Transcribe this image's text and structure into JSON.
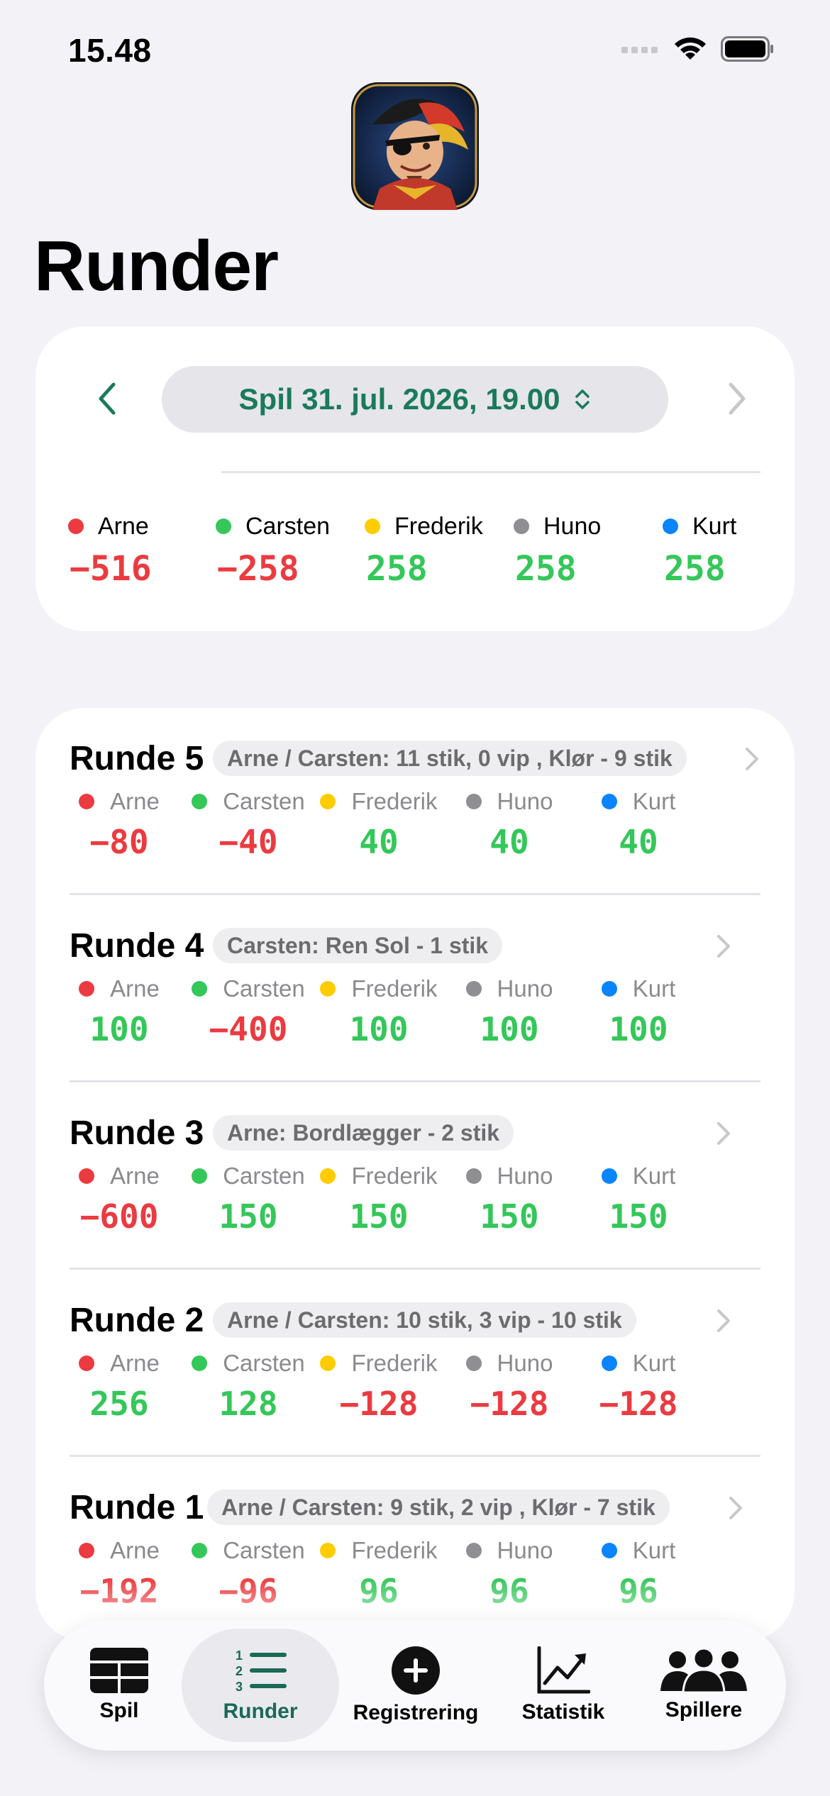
{
  "status_bar": {
    "time": "15.48"
  },
  "app": {
    "title": "Runder"
  },
  "game_picker": {
    "label": "Spil 31. jul. 2026, 19.00"
  },
  "totals": [
    {
      "name": "Arne",
      "color": "#eb3b40",
      "score": "−516",
      "sign": "neg"
    },
    {
      "name": "Carsten",
      "color": "#34c759",
      "score": "−258",
      "sign": "neg"
    },
    {
      "name": "Frederik",
      "color": "#ffcc00",
      "score": "258",
      "sign": "pos"
    },
    {
      "name": "Huno",
      "color": "#8e8e93",
      "score": "258",
      "sign": "pos"
    },
    {
      "name": "Kurt",
      "color": "#0a84ff",
      "score": "258",
      "sign": "pos"
    }
  ],
  "rounds": [
    {
      "title": "Runde 5",
      "desc": "Arne / Carsten: 11 stik, 0 vip , Klør - 9 stik",
      "players": [
        {
          "name": "Arne",
          "color": "#eb3b40",
          "score": "−80",
          "sign": "neg"
        },
        {
          "name": "Carsten",
          "color": "#34c759",
          "score": "−40",
          "sign": "neg"
        },
        {
          "name": "Frederik",
          "color": "#ffcc00",
          "score": "40",
          "sign": "pos"
        },
        {
          "name": "Huno",
          "color": "#8e8e93",
          "score": "40",
          "sign": "pos"
        },
        {
          "name": "Kurt",
          "color": "#0a84ff",
          "score": "40",
          "sign": "pos"
        }
      ]
    },
    {
      "title": "Runde 4",
      "desc": "Carsten: Ren Sol - 1 stik",
      "players": [
        {
          "name": "Arne",
          "color": "#eb3b40",
          "score": "100",
          "sign": "pos"
        },
        {
          "name": "Carsten",
          "color": "#34c759",
          "score": "−400",
          "sign": "neg"
        },
        {
          "name": "Frederik",
          "color": "#ffcc00",
          "score": "100",
          "sign": "pos"
        },
        {
          "name": "Huno",
          "color": "#8e8e93",
          "score": "100",
          "sign": "pos"
        },
        {
          "name": "Kurt",
          "color": "#0a84ff",
          "score": "100",
          "sign": "pos"
        }
      ]
    },
    {
      "title": "Runde 3",
      "desc": "Arne: Bordlægger - 2 stik",
      "players": [
        {
          "name": "Arne",
          "color": "#eb3b40",
          "score": "−600",
          "sign": "neg"
        },
        {
          "name": "Carsten",
          "color": "#34c759",
          "score": "150",
          "sign": "pos"
        },
        {
          "name": "Frederik",
          "color": "#ffcc00",
          "score": "150",
          "sign": "pos"
        },
        {
          "name": "Huno",
          "color": "#8e8e93",
          "score": "150",
          "sign": "pos"
        },
        {
          "name": "Kurt",
          "color": "#0a84ff",
          "score": "150",
          "sign": "pos"
        }
      ]
    },
    {
      "title": "Runde 2",
      "desc": "Arne / Carsten: 10 stik, 3 vip  - 10 stik",
      "players": [
        {
          "name": "Arne",
          "color": "#eb3b40",
          "score": "256",
          "sign": "pos"
        },
        {
          "name": "Carsten",
          "color": "#34c759",
          "score": "128",
          "sign": "pos"
        },
        {
          "name": "Frederik",
          "color": "#ffcc00",
          "score": "−128",
          "sign": "neg"
        },
        {
          "name": "Huno",
          "color": "#8e8e93",
          "score": "−128",
          "sign": "neg"
        },
        {
          "name": "Kurt",
          "color": "#0a84ff",
          "score": "−128",
          "sign": "neg"
        }
      ]
    },
    {
      "title": "Runde 1",
      "desc": "Arne / Carsten: 9 stik, 2 vip , Klør - 7 stik",
      "players": [
        {
          "name": "Arne",
          "color": "#eb3b40",
          "score": "−192",
          "sign": "neg"
        },
        {
          "name": "Carsten",
          "color": "#34c759",
          "score": "−96",
          "sign": "neg"
        },
        {
          "name": "Frederik",
          "color": "#ffcc00",
          "score": "96",
          "sign": "pos"
        },
        {
          "name": "Huno",
          "color": "#8e8e93",
          "score": "96",
          "sign": "pos"
        },
        {
          "name": "Kurt",
          "color": "#0a84ff",
          "score": "96",
          "sign": "pos"
        }
      ]
    }
  ],
  "tab_bar": {
    "active": "Runder",
    "tabs": [
      {
        "label": "Spil",
        "icon": "table-grid-icon"
      },
      {
        "label": "Runder",
        "icon": "numbered-list-icon"
      },
      {
        "label": "Registrering",
        "icon": "plus-circle-icon"
      },
      {
        "label": "Statistik",
        "icon": "line-chart-icon"
      },
      {
        "label": "Spillere",
        "icon": "people-icon"
      }
    ]
  }
}
